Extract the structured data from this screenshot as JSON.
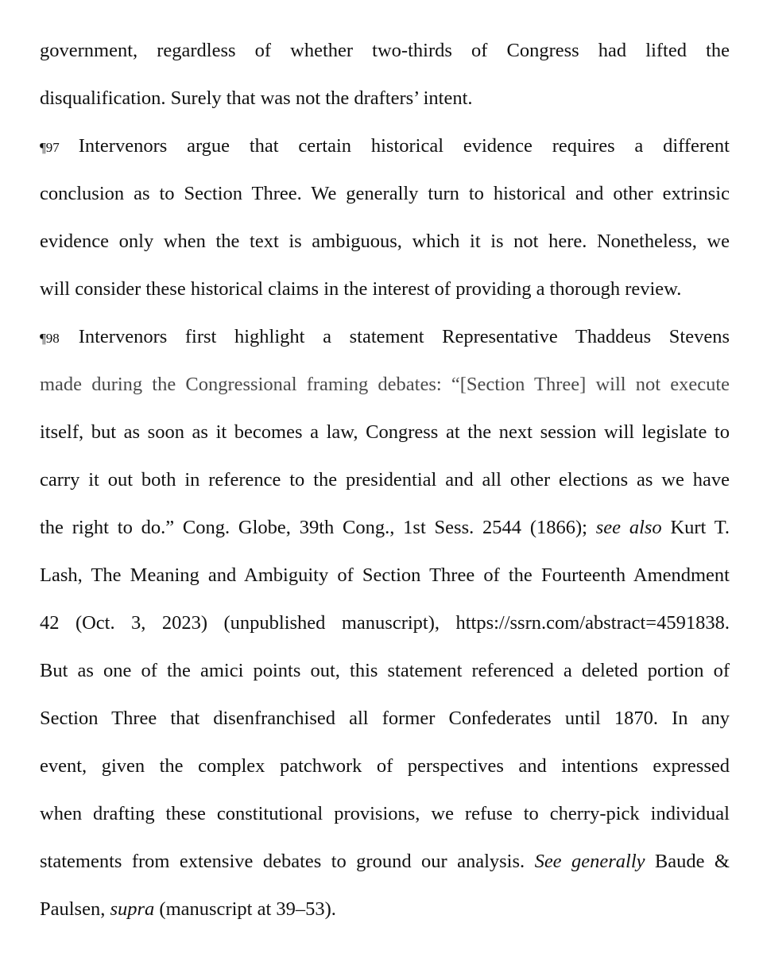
{
  "document": {
    "continuation": {
      "lines": [
        "government, regardless of whether two-thirds of Congress had lifted the",
        "disqualification.  Surely that was not the drafters’ intent."
      ]
    },
    "paragraphs": [
      {
        "number": "¶97",
        "lines": [
          "Intervenors argue that certain historical evidence requires a different",
          "conclusion as to Section Three.  We generally turn to historical and other extrinsic",
          "evidence only when the text is ambiguous, which it is not here.  Nonetheless, we",
          "will consider these historical claims in the interest of providing a thorough review."
        ]
      },
      {
        "number": "¶98",
        "lines": [
          "Intervenors first highlight a statement Representative Thaddeus Stevens",
          "made during the Congressional framing debates: “[Section Three] will not execute",
          "itself, but as soon as it becomes a law, Congress at the next session will legislate to",
          "carry it out both in reference to the presidential and all other elections as we have"
        ],
        "citation_line": {
          "pre": "the right to do.”  Cong. Globe, 39th Cong., 1st Sess. 2544 (1866); ",
          "signal": "see also",
          "post": " Kurt T."
        },
        "more_lines": [
          "Lash, The Meaning and Ambiguity of Section Three of the Fourteenth Amendment",
          "42 (Oct. 3, 2023) (unpublished manuscript), https://ssrn.com/abstract=4591838.",
          "But as one of the amici points out, this statement referenced a deleted portion of",
          "Section Three that disenfranchised all former Confederates until 1870.  In any",
          "event, given the complex patchwork of perspectives and intentions expressed",
          "when drafting these constitutional provisions, we refuse to cherry-pick individual"
        ],
        "closing_line": {
          "pre": "statements from extensive debates to ground our analysis.  ",
          "signal": "See generally",
          "post": " Baude &"
        },
        "final_line": {
          "pre": "Paulsen, ",
          "signal": "supra",
          "post": " (manuscript at 39–53)."
        }
      }
    ]
  }
}
